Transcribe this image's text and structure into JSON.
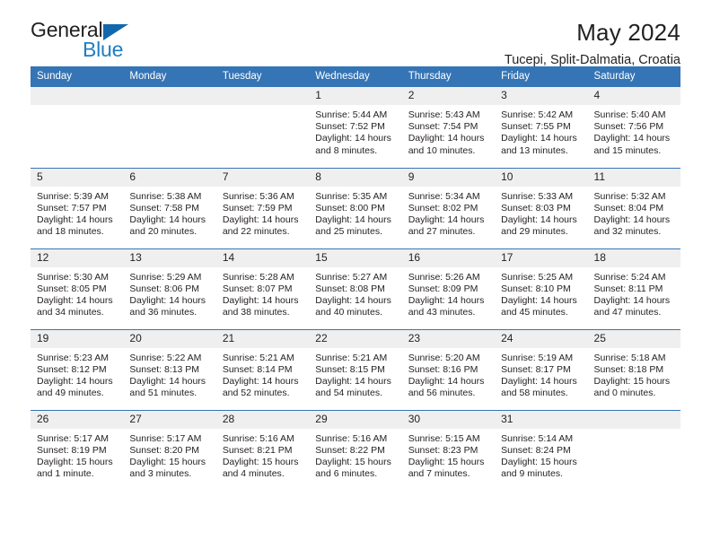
{
  "brand": {
    "name_part1": "General",
    "name_part2": "Blue",
    "triangle_color": "#1268ad",
    "blue_color": "#1d7fc3"
  },
  "header": {
    "title": "May 2024",
    "subtitle": "Tucepi, Split-Dalmatia, Croatia"
  },
  "theme": {
    "header_bg": "#3575b6",
    "daynum_bg": "#efefef",
    "row_divider": "#3575b6",
    "text": "#231f20"
  },
  "weekdays": [
    "Sunday",
    "Monday",
    "Tuesday",
    "Wednesday",
    "Thursday",
    "Friday",
    "Saturday"
  ],
  "labels": {
    "sunrise_prefix": "Sunrise:",
    "sunset_prefix": "Sunset:",
    "daylight_prefix": "Daylight:"
  },
  "weeks": [
    [
      {
        "day": "",
        "empty": true
      },
      {
        "day": "",
        "empty": true
      },
      {
        "day": "",
        "empty": true
      },
      {
        "day": "1",
        "sunrise": "Sunrise: 5:44 AM",
        "sunset": "Sunset: 7:52 PM",
        "daylight_l1": "Daylight: 14 hours",
        "daylight_l2": "and 8 minutes."
      },
      {
        "day": "2",
        "sunrise": "Sunrise: 5:43 AM",
        "sunset": "Sunset: 7:54 PM",
        "daylight_l1": "Daylight: 14 hours",
        "daylight_l2": "and 10 minutes."
      },
      {
        "day": "3",
        "sunrise": "Sunrise: 5:42 AM",
        "sunset": "Sunset: 7:55 PM",
        "daylight_l1": "Daylight: 14 hours",
        "daylight_l2": "and 13 minutes."
      },
      {
        "day": "4",
        "sunrise": "Sunrise: 5:40 AM",
        "sunset": "Sunset: 7:56 PM",
        "daylight_l1": "Daylight: 14 hours",
        "daylight_l2": "and 15 minutes."
      }
    ],
    [
      {
        "day": "5",
        "sunrise": "Sunrise: 5:39 AM",
        "sunset": "Sunset: 7:57 PM",
        "daylight_l1": "Daylight: 14 hours",
        "daylight_l2": "and 18 minutes."
      },
      {
        "day": "6",
        "sunrise": "Sunrise: 5:38 AM",
        "sunset": "Sunset: 7:58 PM",
        "daylight_l1": "Daylight: 14 hours",
        "daylight_l2": "and 20 minutes."
      },
      {
        "day": "7",
        "sunrise": "Sunrise: 5:36 AM",
        "sunset": "Sunset: 7:59 PM",
        "daylight_l1": "Daylight: 14 hours",
        "daylight_l2": "and 22 minutes."
      },
      {
        "day": "8",
        "sunrise": "Sunrise: 5:35 AM",
        "sunset": "Sunset: 8:00 PM",
        "daylight_l1": "Daylight: 14 hours",
        "daylight_l2": "and 25 minutes."
      },
      {
        "day": "9",
        "sunrise": "Sunrise: 5:34 AM",
        "sunset": "Sunset: 8:02 PM",
        "daylight_l1": "Daylight: 14 hours",
        "daylight_l2": "and 27 minutes."
      },
      {
        "day": "10",
        "sunrise": "Sunrise: 5:33 AM",
        "sunset": "Sunset: 8:03 PM",
        "daylight_l1": "Daylight: 14 hours",
        "daylight_l2": "and 29 minutes."
      },
      {
        "day": "11",
        "sunrise": "Sunrise: 5:32 AM",
        "sunset": "Sunset: 8:04 PM",
        "daylight_l1": "Daylight: 14 hours",
        "daylight_l2": "and 32 minutes."
      }
    ],
    [
      {
        "day": "12",
        "sunrise": "Sunrise: 5:30 AM",
        "sunset": "Sunset: 8:05 PM",
        "daylight_l1": "Daylight: 14 hours",
        "daylight_l2": "and 34 minutes."
      },
      {
        "day": "13",
        "sunrise": "Sunrise: 5:29 AM",
        "sunset": "Sunset: 8:06 PM",
        "daylight_l1": "Daylight: 14 hours",
        "daylight_l2": "and 36 minutes."
      },
      {
        "day": "14",
        "sunrise": "Sunrise: 5:28 AM",
        "sunset": "Sunset: 8:07 PM",
        "daylight_l1": "Daylight: 14 hours",
        "daylight_l2": "and 38 minutes."
      },
      {
        "day": "15",
        "sunrise": "Sunrise: 5:27 AM",
        "sunset": "Sunset: 8:08 PM",
        "daylight_l1": "Daylight: 14 hours",
        "daylight_l2": "and 40 minutes."
      },
      {
        "day": "16",
        "sunrise": "Sunrise: 5:26 AM",
        "sunset": "Sunset: 8:09 PM",
        "daylight_l1": "Daylight: 14 hours",
        "daylight_l2": "and 43 minutes."
      },
      {
        "day": "17",
        "sunrise": "Sunrise: 5:25 AM",
        "sunset": "Sunset: 8:10 PM",
        "daylight_l1": "Daylight: 14 hours",
        "daylight_l2": "and 45 minutes."
      },
      {
        "day": "18",
        "sunrise": "Sunrise: 5:24 AM",
        "sunset": "Sunset: 8:11 PM",
        "daylight_l1": "Daylight: 14 hours",
        "daylight_l2": "and 47 minutes."
      }
    ],
    [
      {
        "day": "19",
        "sunrise": "Sunrise: 5:23 AM",
        "sunset": "Sunset: 8:12 PM",
        "daylight_l1": "Daylight: 14 hours",
        "daylight_l2": "and 49 minutes."
      },
      {
        "day": "20",
        "sunrise": "Sunrise: 5:22 AM",
        "sunset": "Sunset: 8:13 PM",
        "daylight_l1": "Daylight: 14 hours",
        "daylight_l2": "and 51 minutes."
      },
      {
        "day": "21",
        "sunrise": "Sunrise: 5:21 AM",
        "sunset": "Sunset: 8:14 PM",
        "daylight_l1": "Daylight: 14 hours",
        "daylight_l2": "and 52 minutes."
      },
      {
        "day": "22",
        "sunrise": "Sunrise: 5:21 AM",
        "sunset": "Sunset: 8:15 PM",
        "daylight_l1": "Daylight: 14 hours",
        "daylight_l2": "and 54 minutes."
      },
      {
        "day": "23",
        "sunrise": "Sunrise: 5:20 AM",
        "sunset": "Sunset: 8:16 PM",
        "daylight_l1": "Daylight: 14 hours",
        "daylight_l2": "and 56 minutes."
      },
      {
        "day": "24",
        "sunrise": "Sunrise: 5:19 AM",
        "sunset": "Sunset: 8:17 PM",
        "daylight_l1": "Daylight: 14 hours",
        "daylight_l2": "and 58 minutes."
      },
      {
        "day": "25",
        "sunrise": "Sunrise: 5:18 AM",
        "sunset": "Sunset: 8:18 PM",
        "daylight_l1": "Daylight: 15 hours",
        "daylight_l2": "and 0 minutes."
      }
    ],
    [
      {
        "day": "26",
        "sunrise": "Sunrise: 5:17 AM",
        "sunset": "Sunset: 8:19 PM",
        "daylight_l1": "Daylight: 15 hours",
        "daylight_l2": "and 1 minute."
      },
      {
        "day": "27",
        "sunrise": "Sunrise: 5:17 AM",
        "sunset": "Sunset: 8:20 PM",
        "daylight_l1": "Daylight: 15 hours",
        "daylight_l2": "and 3 minutes."
      },
      {
        "day": "28",
        "sunrise": "Sunrise: 5:16 AM",
        "sunset": "Sunset: 8:21 PM",
        "daylight_l1": "Daylight: 15 hours",
        "daylight_l2": "and 4 minutes."
      },
      {
        "day": "29",
        "sunrise": "Sunrise: 5:16 AM",
        "sunset": "Sunset: 8:22 PM",
        "daylight_l1": "Daylight: 15 hours",
        "daylight_l2": "and 6 minutes."
      },
      {
        "day": "30",
        "sunrise": "Sunrise: 5:15 AM",
        "sunset": "Sunset: 8:23 PM",
        "daylight_l1": "Daylight: 15 hours",
        "daylight_l2": "and 7 minutes."
      },
      {
        "day": "31",
        "sunrise": "Sunrise: 5:14 AM",
        "sunset": "Sunset: 8:24 PM",
        "daylight_l1": "Daylight: 15 hours",
        "daylight_l2": "and 9 minutes."
      },
      {
        "day": "",
        "empty": true
      }
    ]
  ]
}
